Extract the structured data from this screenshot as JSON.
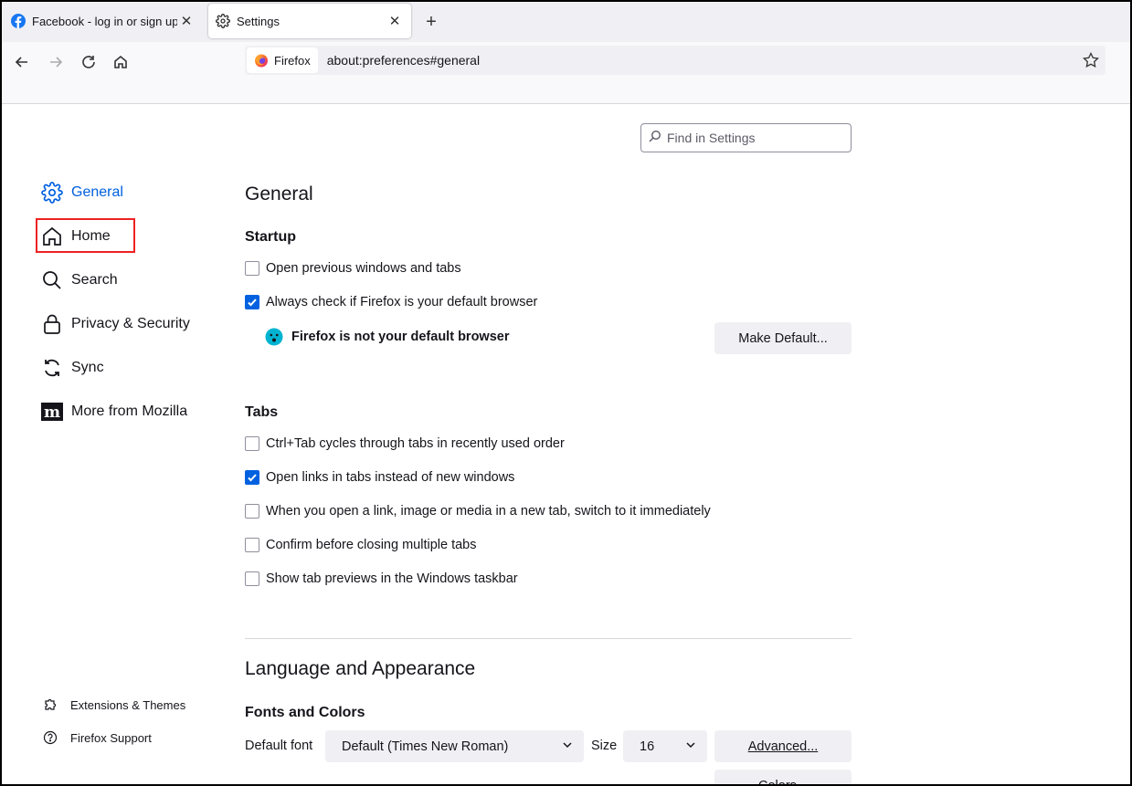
{
  "tabs": [
    {
      "title": "Facebook - log in or sign up",
      "icon": "facebook-icon",
      "active": false
    },
    {
      "title": "Settings",
      "icon": "gear-icon",
      "active": true
    }
  ],
  "navbar": {
    "identity_label": "Firefox",
    "url": "about:preferences#general"
  },
  "search": {
    "placeholder": "Find in Settings"
  },
  "sidebar": {
    "items": [
      {
        "label": "General",
        "icon": "gear-icon",
        "selected": true
      },
      {
        "label": "Home",
        "icon": "home-icon"
      },
      {
        "label": "Search",
        "icon": "search-icon"
      },
      {
        "label": "Privacy & Security",
        "icon": "lock-icon"
      },
      {
        "label": "Sync",
        "icon": "sync-icon"
      },
      {
        "label": "More from Mozilla",
        "icon": "mozilla-icon"
      }
    ],
    "footer": [
      {
        "label": "Extensions & Themes",
        "icon": "puzzle-icon"
      },
      {
        "label": "Firefox Support",
        "icon": "help-icon"
      }
    ]
  },
  "main": {
    "title": "General",
    "startup": {
      "heading": "Startup",
      "options": [
        {
          "label": "Open previous windows and tabs",
          "checked": false
        },
        {
          "label": "Always check if Firefox is your default browser",
          "checked": true
        }
      ],
      "notice": "Firefox is not your default browser",
      "make_default_label": "Make Default..."
    },
    "tabs_section": {
      "heading": "Tabs",
      "options": [
        {
          "label": "Ctrl+Tab cycles through tabs in recently used order",
          "checked": false
        },
        {
          "label": "Open links in tabs instead of new windows",
          "checked": true
        },
        {
          "label": "When you open a link, image or media in a new tab, switch to it immediately",
          "checked": false
        },
        {
          "label": "Confirm before closing multiple tabs",
          "checked": false
        },
        {
          "label": "Show tab previews in the Windows taskbar",
          "checked": false
        }
      ]
    },
    "language": {
      "title": "Language and Appearance",
      "fonts_heading": "Fonts and Colors",
      "default_font_label": "Default font",
      "default_font_value": "Default (Times New Roman)",
      "size_label": "Size",
      "size_value": "16",
      "advanced_label": "Advanced...",
      "colors_label": "Colors..."
    }
  },
  "colors": {
    "accent": "#0061e0",
    "highlight_box": "#ee2222"
  }
}
